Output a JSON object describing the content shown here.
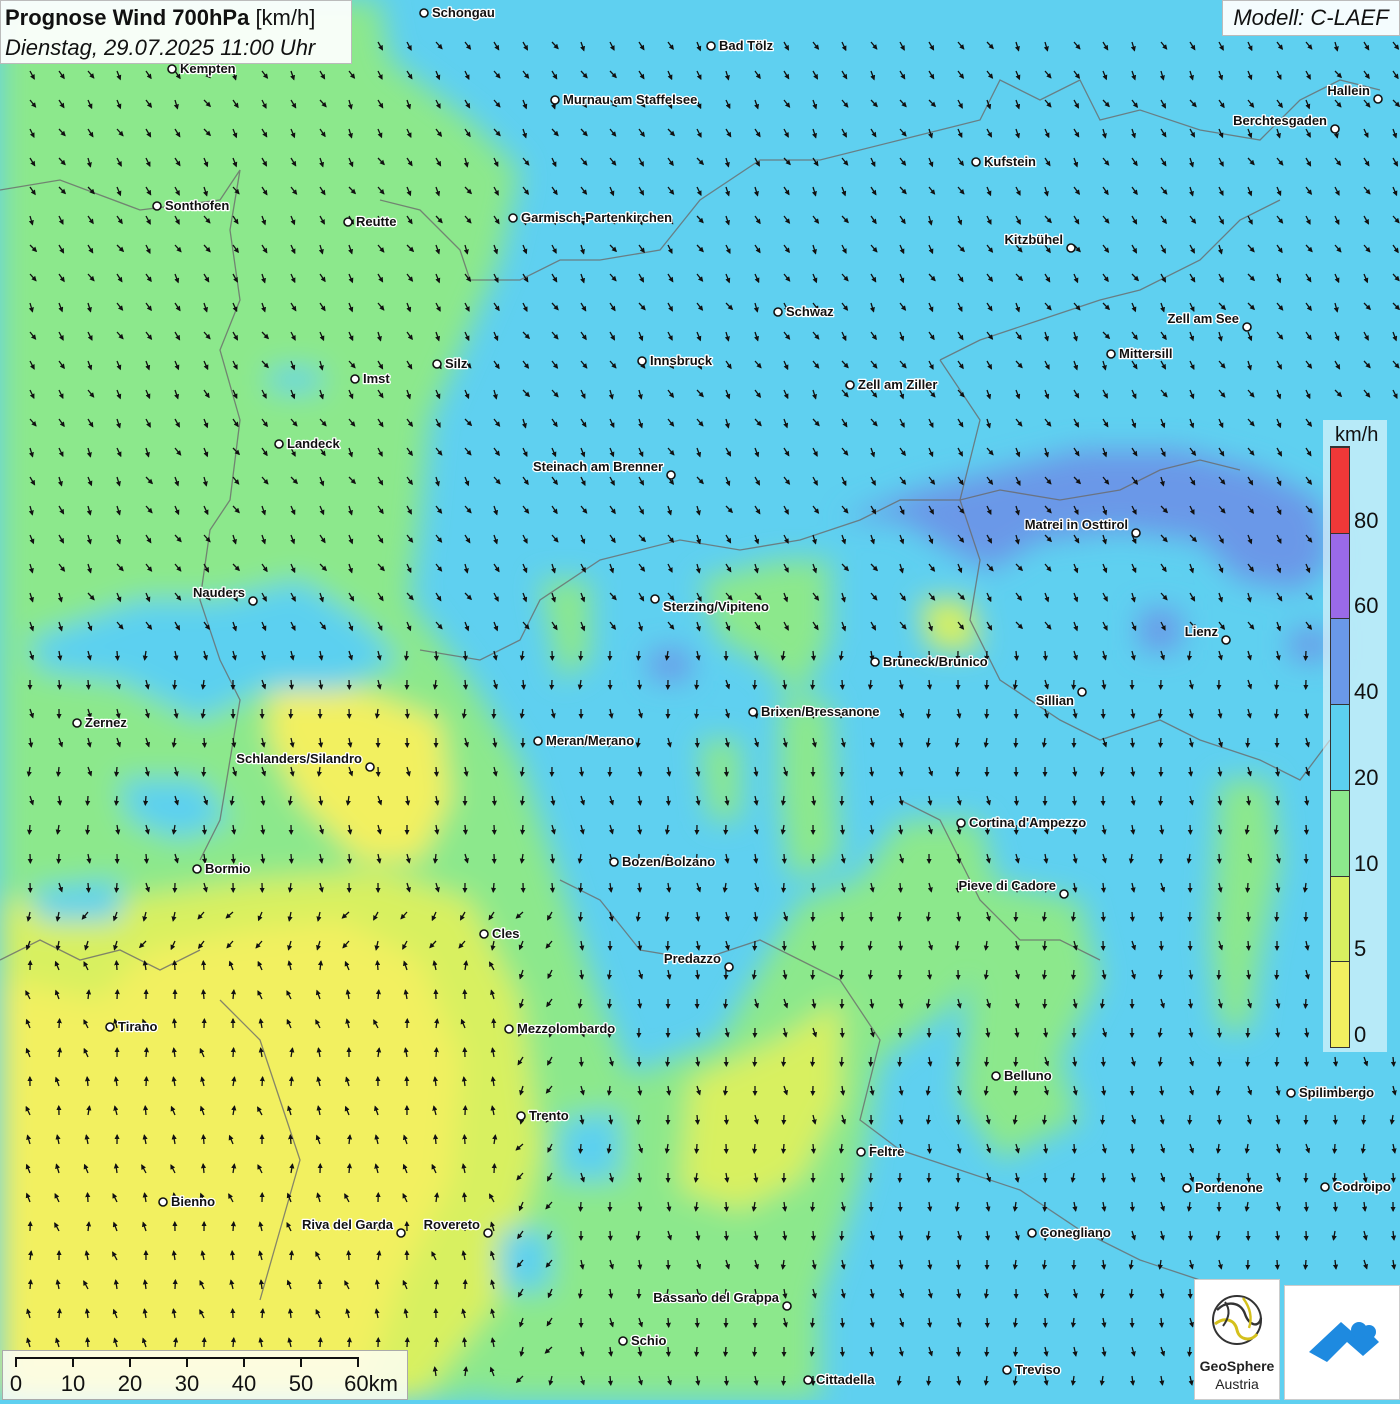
{
  "header": {
    "title_bold": "Prognose Wind 700hPa",
    "title_unit": "[km/h]",
    "datetime": "Dienstag, 29.07.2025 11:00 Uhr"
  },
  "model": {
    "label": "Modell: C-LAEF"
  },
  "legend": {
    "unit": "km/h",
    "colors": [
      "#f2f060",
      "#d8f060",
      "#8ce88c",
      "#5cd0f0",
      "#6a98e8",
      "#9a6ae8",
      "#f03838"
    ],
    "labels": [
      "0",
      "5",
      "10",
      "20",
      "40",
      "60",
      "80"
    ]
  },
  "scale": {
    "labels": [
      "0",
      "10",
      "20",
      "30",
      "40",
      "50",
      "60km"
    ]
  },
  "logos": {
    "geosphere_line1": "GeoSphere",
    "geosphere_line2": "Austria"
  },
  "colors": {
    "wind_0_5": "#f2f060",
    "wind_5_10": "#d8f060",
    "wind_10_20": "#8ce88c",
    "wind_20_40": "#5cd0f0",
    "wind_40_60": "#6a98e8",
    "wind_60_80": "#9a6ae8",
    "brand_blue": "#1e8ae0"
  },
  "cities": [
    {
      "name": "Schongau"
    },
    {
      "name": "Bad Tölz"
    },
    {
      "name": "Kempten"
    },
    {
      "name": "Murnau am Staffelsee"
    },
    {
      "name": "Hallein"
    },
    {
      "name": "Berchtesgaden"
    },
    {
      "name": "Kufstein"
    },
    {
      "name": "Sonthofen"
    },
    {
      "name": "Reutte"
    },
    {
      "name": "Garmisch-Partenkirchen"
    },
    {
      "name": "Kitzbühel"
    },
    {
      "name": "Schwaz"
    },
    {
      "name": "Zell am See"
    },
    {
      "name": "Mittersill"
    },
    {
      "name": "Innsbruck"
    },
    {
      "name": "Silz"
    },
    {
      "name": "Imst"
    },
    {
      "name": "Zell am Ziller"
    },
    {
      "name": "Landeck"
    },
    {
      "name": "Steinach am Brenner"
    },
    {
      "name": "Matrei in Osttirol"
    },
    {
      "name": "Nauders"
    },
    {
      "name": "Sterzing/Vipiteno"
    },
    {
      "name": "Lienz"
    },
    {
      "name": "Bruneck/Brunico"
    },
    {
      "name": "Sillian"
    },
    {
      "name": "Brixen/Bressanone"
    },
    {
      "name": "Zernez"
    },
    {
      "name": "Meran/Merano"
    },
    {
      "name": "Schlanders/Silandro"
    },
    {
      "name": "Cortina d'Ampezzo"
    },
    {
      "name": "Bozen/Bolzano"
    },
    {
      "name": "Bormio"
    },
    {
      "name": "Pieve di Cadore"
    },
    {
      "name": "Cles"
    },
    {
      "name": "Predazzo"
    },
    {
      "name": "Tirano"
    },
    {
      "name": "Mezzolombardo"
    },
    {
      "name": "Belluno"
    },
    {
      "name": "Spilimbergo"
    },
    {
      "name": "Trento"
    },
    {
      "name": "Feltre"
    },
    {
      "name": "Bienno"
    },
    {
      "name": "Pordenone"
    },
    {
      "name": "Codroipo"
    },
    {
      "name": "Riva del Garda"
    },
    {
      "name": "Rovereto"
    },
    {
      "name": "Conegliano"
    },
    {
      "name": "Bassano del Grappa"
    },
    {
      "name": "Schio"
    },
    {
      "name": "Treviso"
    },
    {
      "name": "Cittadella"
    }
  ]
}
